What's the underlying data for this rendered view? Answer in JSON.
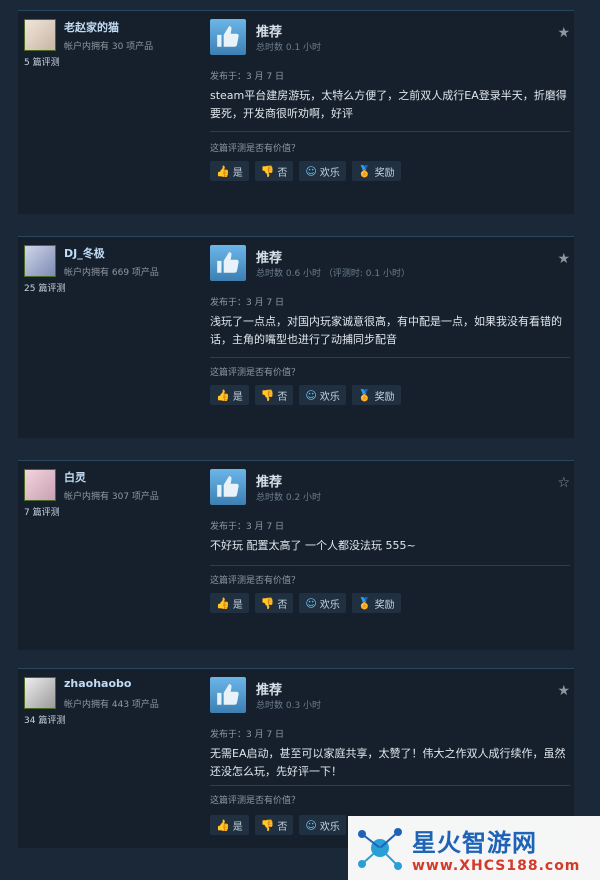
{
  "reviews": [
    {
      "user": "老赵家的猫",
      "owned": "帐户内拥有 30 项产品",
      "review_count": "5 篇评测",
      "recommend": "推荐",
      "hours": "总时数 0.1 小时",
      "date": "发布于：3 月 7 日",
      "text": "steam平台建房游玩，太特么方便了，之前双人成行EA登录半天，折磨得要死，开发商很听劝啊，好评",
      "helpful_q": "这篇评测是否有价值？",
      "yes": "是",
      "no": "否",
      "funny": "欢乐",
      "award": "奖励"
    },
    {
      "user": "DJ_冬极",
      "owned": "帐户内拥有 669 项产品",
      "review_count": "25 篇评测",
      "recommend": "推荐",
      "hours": "总时数 0.6 小时 （评测时: 0.1 小时）",
      "date": "发布于：3 月 7 日",
      "text": "浅玩了一点点，对国内玩家诚意很高，有中配是一点，如果我没有看错的话，主角的嘴型也进行了动捕同步配音",
      "helpful_q": "这篇评测是否有价值？",
      "yes": "是",
      "no": "否",
      "funny": "欢乐",
      "award": "奖励"
    },
    {
      "user": "白灵",
      "owned": "帐户内拥有 307 项产品",
      "review_count": "7 篇评测",
      "recommend": "推荐",
      "hours": "总时数 0.2 小时",
      "date": "发布于：3 月 7 日",
      "text": "不好玩 配置太高了 一个人都没法玩 555~",
      "helpful_q": "这篇评测是否有价值？",
      "yes": "是",
      "no": "否",
      "funny": "欢乐",
      "award": "奖励"
    },
    {
      "user": "zhaohaobo",
      "owned": "帐户内拥有 443 项产品",
      "review_count": "34 篇评测",
      "recommend": "推荐",
      "hours": "总时数 0.3 小时",
      "date": "发布于：3 月 7 日",
      "text": "无需EA启动，甚至可以家庭共享，太赞了！伟大之作双人成行续作，虽然还没怎么玩，先好评一下！",
      "helpful_q": "这篇评测是否有价值？",
      "yes": "是",
      "no": "否",
      "funny": "欢乐",
      "award": ""
    }
  ],
  "watermark": {
    "title": "星火智游网",
    "url": "www.XHCS188.com"
  }
}
